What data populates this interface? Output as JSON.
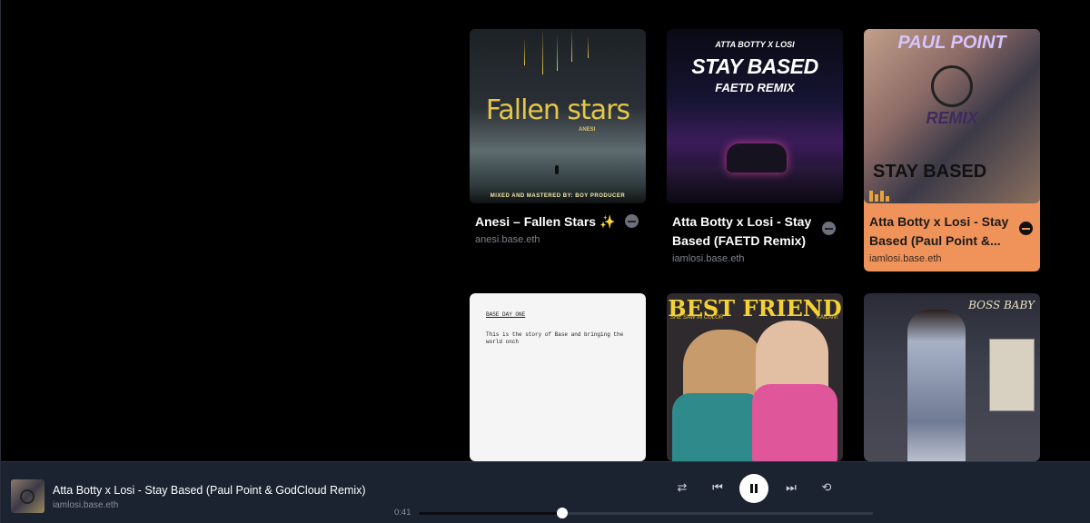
{
  "cards": [
    {
      "title": "Anesi – Fallen Stars ✨",
      "subtitle": "anesi.base.eth",
      "art_title": "Fallen stars",
      "art_artist": "ANESI",
      "art_credit": "MIXED AND MASTERED BY: BOY PRODUCER"
    },
    {
      "title": "Atta Botty x Losi - Stay Based (FAETD Remix)",
      "subtitle": "iamlosi.base.eth",
      "art_line1": "ATTA BOTTY X LOSI",
      "art_line2": "STAY BASED",
      "art_line3": "FAETD REMIX"
    },
    {
      "title": "Atta Botty x Losi - Stay Based (Paul Point &...",
      "subtitle": "iamlosi.base.eth",
      "art_line1": "PAUL POINT",
      "art_line2": "REMIX",
      "art_line3": "STAY BASED",
      "active_color": "#f0935a"
    },
    {
      "art_heading": "BASE DAY ONE",
      "art_text": "This is the story of Base and bringing the world onch"
    },
    {
      "art_title": "BEST FRIEND",
      "art_sub": "SHE SAW IN COLOR",
      "art_artist": "KAILANI"
    },
    {
      "art_title": "BOSS BABY"
    }
  ],
  "player": {
    "title": "Atta Botty x Losi - Stay Based (Paul Point & GodCloud Remix)",
    "subtitle": "iamlosi.base.eth",
    "time": "0:41",
    "progress": 0.315,
    "controls": [
      "shuffle-icon",
      "previous-icon",
      "pause-icon",
      "next-icon",
      "repeat-icon"
    ]
  }
}
